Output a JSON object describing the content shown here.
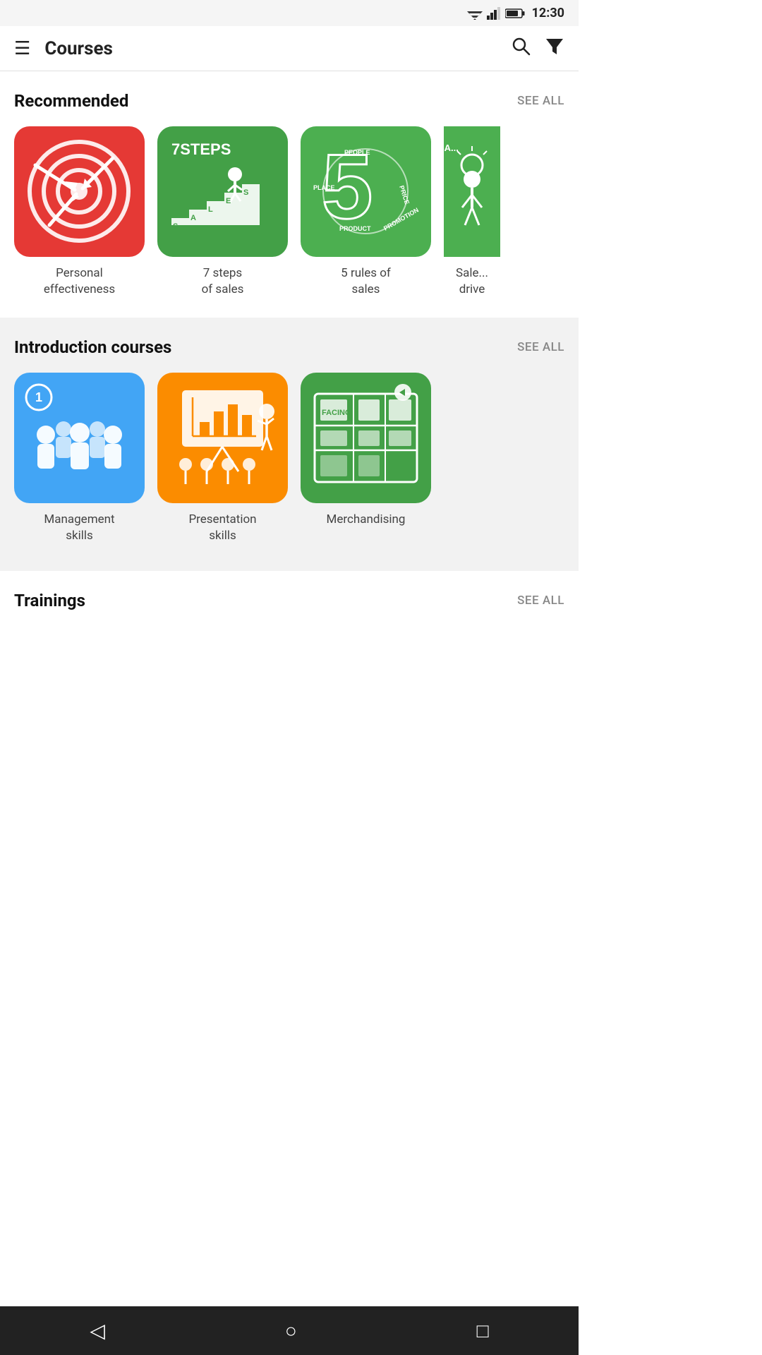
{
  "statusBar": {
    "time": "12:30"
  },
  "header": {
    "title": "Courses",
    "menuIcon": "☰",
    "searchIcon": "🔍",
    "filterIcon": "▼"
  },
  "recommended": {
    "sectionTitle": "Recommended",
    "seeAll": "SEE ALL",
    "courses": [
      {
        "label": "Personal effectiveness",
        "color": "card-red",
        "icon": "target"
      },
      {
        "label": "7 steps of sales",
        "color": "card-green",
        "icon": "steps"
      },
      {
        "label": "5 rules of sales",
        "color": "card-green2",
        "icon": "five"
      },
      {
        "label": "Sales drive",
        "color": "card-green2",
        "icon": "bulb"
      }
    ]
  },
  "introduction": {
    "sectionTitle": "Introduction courses",
    "seeAll": "SEE ALL",
    "courses": [
      {
        "label": "Management skills",
        "color": "card-blue",
        "icon": "people"
      },
      {
        "label": "Presentation skills",
        "color": "card-orange",
        "icon": "presentation"
      },
      {
        "label": "Merchandising",
        "color": "card-green3",
        "icon": "facing"
      }
    ]
  },
  "trainings": {
    "sectionTitle": "Trainings",
    "seeAll": "SEE ALL"
  },
  "navBar": {
    "back": "◁",
    "home": "○",
    "recent": "□"
  }
}
